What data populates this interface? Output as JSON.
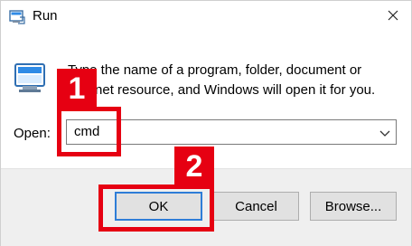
{
  "window": {
    "title": "Run",
    "title_icon": "run-icon",
    "close_icon": "close-icon"
  },
  "content": {
    "icon": "run-program-icon",
    "description_line1": "Type the name of a program, folder, document or",
    "description_line2": "Internet resource, and Windows will open it for you."
  },
  "open_field": {
    "label": "Open:",
    "value": "cmd",
    "dropdown_icon": "chevron-down-icon"
  },
  "buttons": {
    "ok": "OK",
    "cancel": "Cancel",
    "browse": "Browse..."
  },
  "annotations": {
    "step1": "1",
    "step2": "2",
    "color": "#e60012"
  }
}
